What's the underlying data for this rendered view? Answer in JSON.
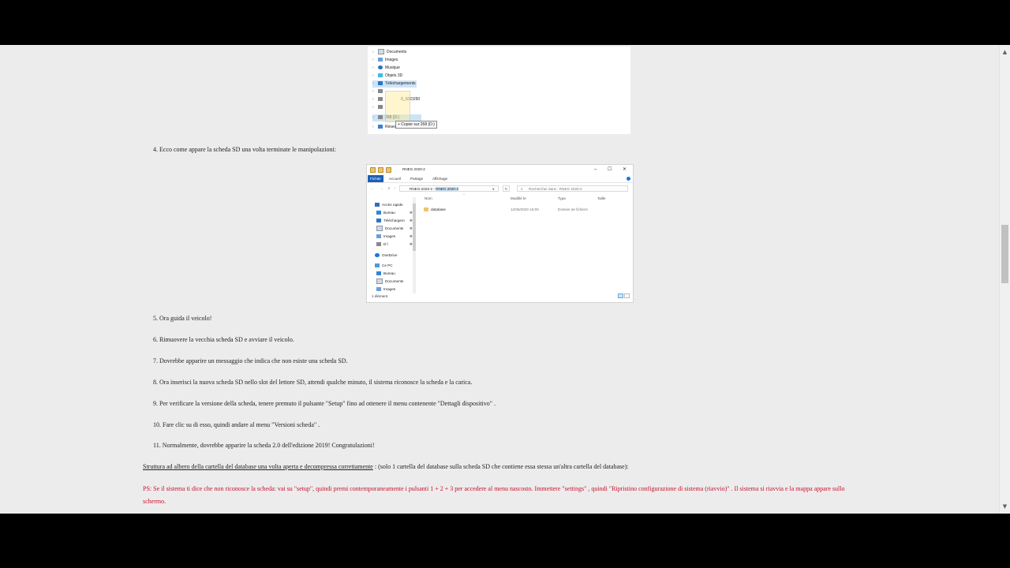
{
  "shot1": {
    "tree": [
      {
        "label": "Documents",
        "icon": "document-icon",
        "selected": false
      },
      {
        "label": "Images",
        "icon": "images-icon",
        "selected": false
      },
      {
        "label": "Musique",
        "icon": "music-icon",
        "selected": false
      },
      {
        "label": "Objets 3D",
        "icon": "objects-3d-icon",
        "selected": false
      },
      {
        "label": "Téléchargements",
        "icon": "download-icon",
        "selected": true
      },
      {
        "label": "",
        "icon": "drive-icon",
        "selected": false
      },
      {
        "label": "0_SSD250",
        "icon": "drive-icon",
        "selected": false
      },
      {
        "label": "",
        "icon": "drive-icon",
        "selected": false
      },
      {
        "label": "268 (D:)",
        "icon": "sd-card-icon",
        "selected": true
      },
      {
        "label": "Réseau",
        "icon": "network-icon",
        "selected": false
      }
    ],
    "drop_tip": "+ Copier sur 268 (D:)"
  },
  "step4": "4. Ecco come appare la scheda SD una volta terminate le manipolazioni:",
  "shot2": {
    "title": "RNEG 2020-2",
    "win_controls": [
      "–",
      "☐",
      "✕"
    ],
    "ribbon_tabs": [
      "Fichier",
      "Accueil",
      "Partage",
      "Affichage"
    ],
    "nav_buttons": [
      "←",
      "→",
      "∨",
      "↑"
    ],
    "address_seg1": "RNEG-2020-2",
    "address_sep": "›",
    "address_seg2": "RNEG 2020-2",
    "address_dropdown": "∨",
    "refresh": "↻",
    "search_placeholder": "Rechercher dans : RNEG 2020-2",
    "search_icon": "⌕",
    "sort_arrow": "^",
    "nav_items": [
      {
        "label": "Accès rapide",
        "icon": "star-icon",
        "pin": ""
      },
      {
        "label": "Bureau",
        "icon": "desktop-icon",
        "pin": "✱"
      },
      {
        "label": "Téléchargem",
        "icon": "download-icon",
        "pin": "✱"
      },
      {
        "label": "Documents",
        "icon": "document-icon",
        "pin": "✱"
      },
      {
        "label": "Images",
        "icon": "images-icon",
        "pin": "✱"
      },
      {
        "label": "D:\\",
        "icon": "drive-icon",
        "pin": "✱"
      },
      {
        "label": "OneDrive",
        "icon": "cloud-icon",
        "pin": ""
      },
      {
        "label": "Ce PC",
        "icon": "pc-icon",
        "pin": ""
      },
      {
        "label": "Bureau",
        "icon": "desktop-icon",
        "pin": ""
      },
      {
        "label": "Documents",
        "icon": "document-icon",
        "pin": ""
      },
      {
        "label": "Images",
        "icon": "images-icon",
        "pin": ""
      }
    ],
    "columns": [
      "Nom",
      "Modifié le",
      "Type",
      "Taille"
    ],
    "rows": [
      {
        "name": "database",
        "modified": "12/05/2020 16:00",
        "type": "Dossier de fichiers",
        "size": ""
      }
    ],
    "status": "1 élément"
  },
  "steps": [
    "5. Ora guida il veicolo!",
    "6. Rimuovere la vecchia scheda SD e avviare il veicolo.",
    "7. Dovrebbe apparire un messaggio che indica che non esiste una scheda SD.",
    "8. Ora inserisci la nuova scheda SD nello slot del lettore SD, attendi qualche minuto, il sistema riconosce la scheda e la carica.",
    "9. Per verificare la versione della scheda, tenere premuto il pulsante \"Setup\" fino ad ottenere il menu contenente \"Dettagli dispositivo\" .",
    "10. Fare clic su di esso, quindi andare al menu \"Versioni scheda\" .",
    "11. Normalmente, dovrebbe apparire la scheda 2.0 dell'edizione 2019! Congratulazioni!"
  ],
  "structure_link": "Struttura ad albero della cartella del database una volta aperta e decompressa correttamente",
  "structure_rest": " : (solo 1 cartella del database sulla scheda SD che contiene essa stessa un'altra cartella del database):",
  "ps_note": "PS: Se il sistema ti dice che non riconosce la scheda: vai su \"setup\", quindi premi contemporaneamente i pulsanti 1 + 2 + 3 per accedere al menu nascosto. Immettere \"settings\" , quindi \"Ripristino configurazione di sistema (riavvio)\" . Il sistema si riavvia e la mappa appare sullo schermo.",
  "scrollbar": {
    "up": "▲",
    "down": "▼"
  },
  "colors": {
    "page_bg": "#ececec",
    "ps_text": "#c8102e",
    "ribbon_file": "#1a5fb4"
  }
}
